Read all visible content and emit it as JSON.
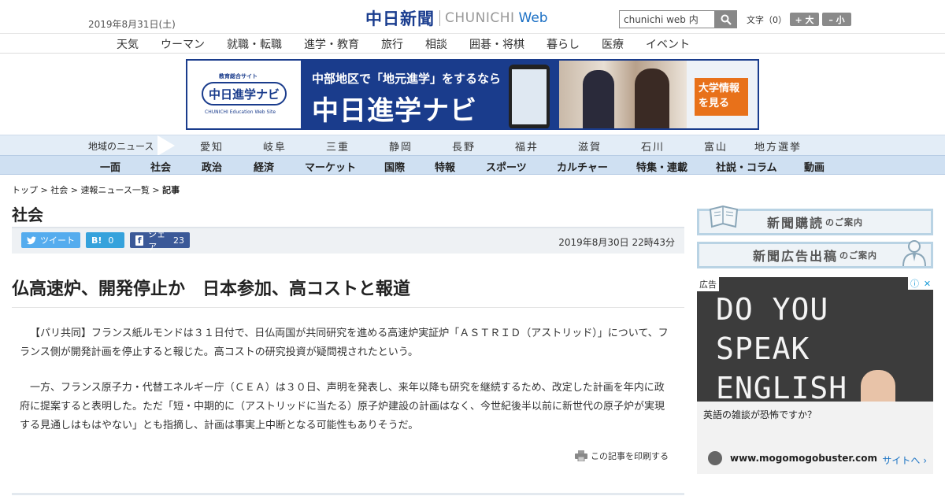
{
  "header": {
    "date": "2019年8月31日(土)",
    "logo_jp": "中日新聞",
    "logo_en": "CHUNICHI",
    "logo_web": "Web",
    "search_value": "chunichi web 内",
    "fontsize_label": "文字（0）",
    "fontsize_up": "+ 大",
    "fontsize_down": "– 小"
  },
  "topnav": [
    "天気",
    "ウーマン",
    "就職・転職",
    "進学・教育",
    "旅行",
    "相談",
    "囲碁・将棋",
    "暮らし",
    "医療",
    "イベント"
  ],
  "banner": {
    "site_label": "教育総合サイト",
    "logo_text": "中日進学ナビ",
    "logo_sub": "CHUNICHI Education Web Site",
    "tagline": "中部地区で「地元進学」をするなら",
    "title": "中日進学ナビ",
    "cta": "大学情報を見る"
  },
  "regionnav": {
    "label": "地域のニュース",
    "items": [
      "愛知",
      "岐阜",
      "三重",
      "静岡",
      "長野",
      "福井",
      "滋賀",
      "石川",
      "富山",
      "地方選挙"
    ]
  },
  "catnav": [
    "一面",
    "社会",
    "政治",
    "経済",
    "マーケット",
    "国際",
    "特報",
    "スポーツ",
    "カルチャー",
    "特集・連載",
    "社説・コラム",
    "動画"
  ],
  "breadcrumb": {
    "items": [
      "トップ",
      "社会",
      "速報ニュース一覧"
    ],
    "sep": " > ",
    "current": "記事"
  },
  "section_title": "社会",
  "share": {
    "tweet": "ツイート",
    "hatena_label": "B!",
    "hatena_count": "0",
    "facebook_label": "シェア",
    "facebook_count": "23",
    "timestamp": "2019年8月30日 22時43分"
  },
  "article": {
    "headline": "仏高速炉、開発停止か　日本参加、高コストと報道",
    "paragraphs": [
      "【パリ共同】フランス紙ルモンドは３１日付で、日仏両国が共同研究を進める高速炉実証炉「ＡＳＴＲＩＤ（アストリッド）」について、フランス側が開発計画を停止すると報じた。高コストの研究投資が疑問視されたという。",
      "一方、フランス原子力・代替エネルギー庁（ＣＥＡ）は３０日、声明を発表し、来年以降も研究を継続するため、改定した計画を年内に政府に提案すると表明した。ただ「短・中期的に（アストリッドに当たる）原子炉建設の計画はなく、今世紀後半以前に新世代の原子炉が実現する見通しはもはやない」とも指摘し、計画は事実上中断となる可能性もありそうだ。"
    ],
    "print_label": "この記事を印刷する"
  },
  "sidebar": {
    "subscribe_main": "新聞購読",
    "subscribe_sub": "のご案内",
    "adguide_main": "新聞広告出稿",
    "adguide_sub": "のご案内"
  },
  "ad": {
    "label": "広告",
    "chalk_line1": "DO YOU SPEAK",
    "chalk_line2": "ENGLISH ?",
    "question": "英語の雑談が恐怖ですか？",
    "domain": "www.mogomogobuster.com",
    "site_link": "サイトへ"
  }
}
